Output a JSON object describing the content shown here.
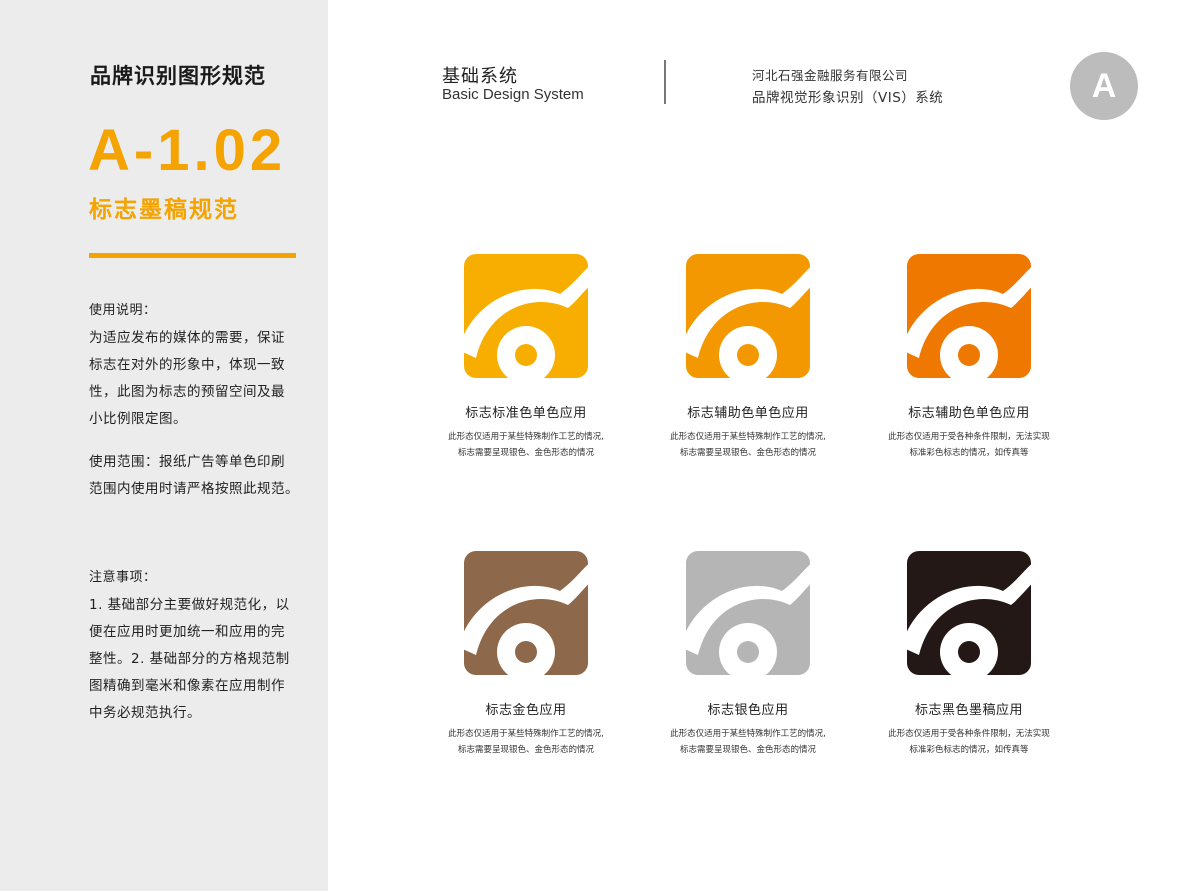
{
  "sidebar": {
    "heading": "品牌识别图形规范",
    "code": "A-1.02",
    "subtitle": "标志墨稿规范",
    "usage_label": "使用说明：",
    "usage_lines": [
      "为适应发布的媒体的需要，保证",
      "标志在对外的形象中，体现一致",
      "性，此图为标志的预留空间及最",
      "小比例限定图。"
    ],
    "scope_lines": [
      "使用范围：报纸广告等单色印刷",
      "范围内使用时请严格按照此规范。"
    ],
    "notes_label": "注意事项：",
    "notes_lines": [
      "1. 基础部分主要做好规范化，以",
      "便在应用时更加统一和应用的完",
      "整性。2. 基础部分的方格规范制",
      "图精确到毫米和像素在应用制作",
      "中务必规范执行。"
    ]
  },
  "header": {
    "section_title": "基础系统",
    "section_subtitle": "Basic Design System",
    "company": "河北石强金融服务有限公司",
    "system_name": "品牌视觉形象识别（VIS）系统",
    "badge": "A"
  },
  "logos": [
    {
      "color": "#f7ae00",
      "label": "标志标准色单色应用",
      "note": [
        "此形态仅适用于某些特殊制作工艺的情况,",
        "标志需要呈现银色、金色形态的情况"
      ]
    },
    {
      "color": "#f39800",
      "label": "标志辅助色单色应用",
      "note": [
        "此形态仅适用于某些特殊制作工艺的情况,",
        "标志需要呈现银色、金色形态的情况"
      ]
    },
    {
      "color": "#ee7800",
      "label": "标志辅助色单色应用",
      "note": [
        "此形态仅适用于受各种条件限制，无法实现",
        "标准彩色标志的情况，如传真等"
      ]
    },
    {
      "color": "#8d684b",
      "label": "标志金色应用",
      "note": [
        "此形态仅适用于某些特殊制作工艺的情况,",
        "标志需要呈现银色、金色形态的情况"
      ]
    },
    {
      "color": "#b5b5b5",
      "label": "标志银色应用",
      "note": [
        "此形态仅适用于某些特殊制作工艺的情况,",
        "标志需要呈现银色、金色形态的情况"
      ]
    },
    {
      "color": "#231815",
      "label": "标志黑色墨稿应用",
      "note": [
        "此形态仅适用于受各种条件限制，无法实现",
        "标准彩色标志的情况，如传真等"
      ]
    }
  ]
}
